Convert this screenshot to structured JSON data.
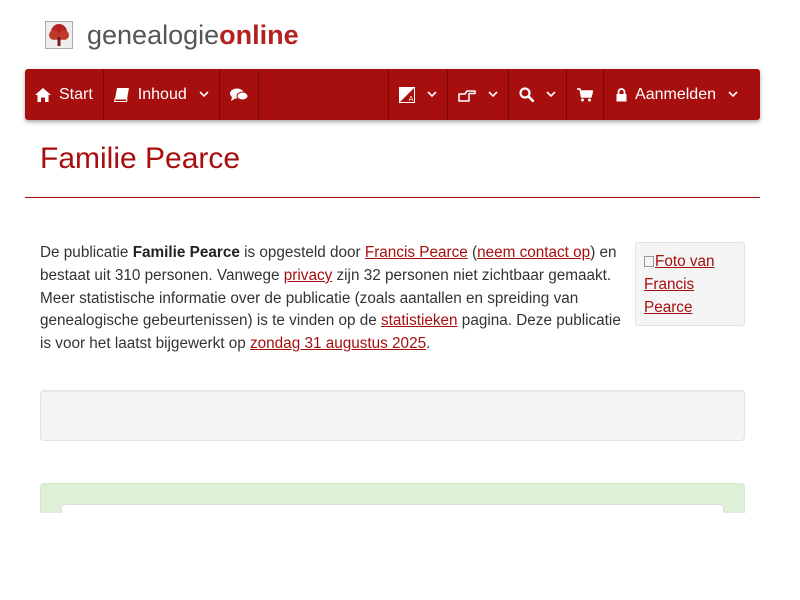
{
  "brand": {
    "part1": "genealogie",
    "part2": "online"
  },
  "nav": {
    "start": "Start",
    "contents": "Inhoud",
    "login": "Aanmelden",
    "icons": {
      "start": "home-icon",
      "contents": "book-icon",
      "chat": "comments-icon",
      "language": "language-icon",
      "share": "hand-pointing-icon",
      "search": "search-icon",
      "cart": "shopping-cart-icon",
      "lock": "lock-icon",
      "chevron": "chevron-down-icon"
    }
  },
  "page": {
    "title": "Familie Pearce"
  },
  "intro": {
    "t1": "De publicatie ",
    "pub_name": "Familie Pearce",
    "t2": " is opgesteld door ",
    "author": "Francis Pearce",
    "t3": " (",
    "contact": "neem contact op",
    "t4": ") en bestaat uit 310 personen. Vanwege ",
    "privacy": "privacy",
    "t5": " zijn 32 personen niet zichtbaar gemaakt. Meer statistische informatie over de publicatie (zoals aantallen en spreiding van genealogische gebeurtenissen) is te vinden op de ",
    "stats": "statistieken",
    "t6": " pagina. Deze publicatie is voor het laatst bijgewerkt op ",
    "updated": "zondag 31 augustus 2025",
    "t7": "."
  },
  "photo": {
    "alt": "Foto van Francis Pearce"
  },
  "colors": {
    "brand_red": "#a70e0e",
    "panel_green": "#dff0d8",
    "well_gray": "#f5f5f5"
  }
}
